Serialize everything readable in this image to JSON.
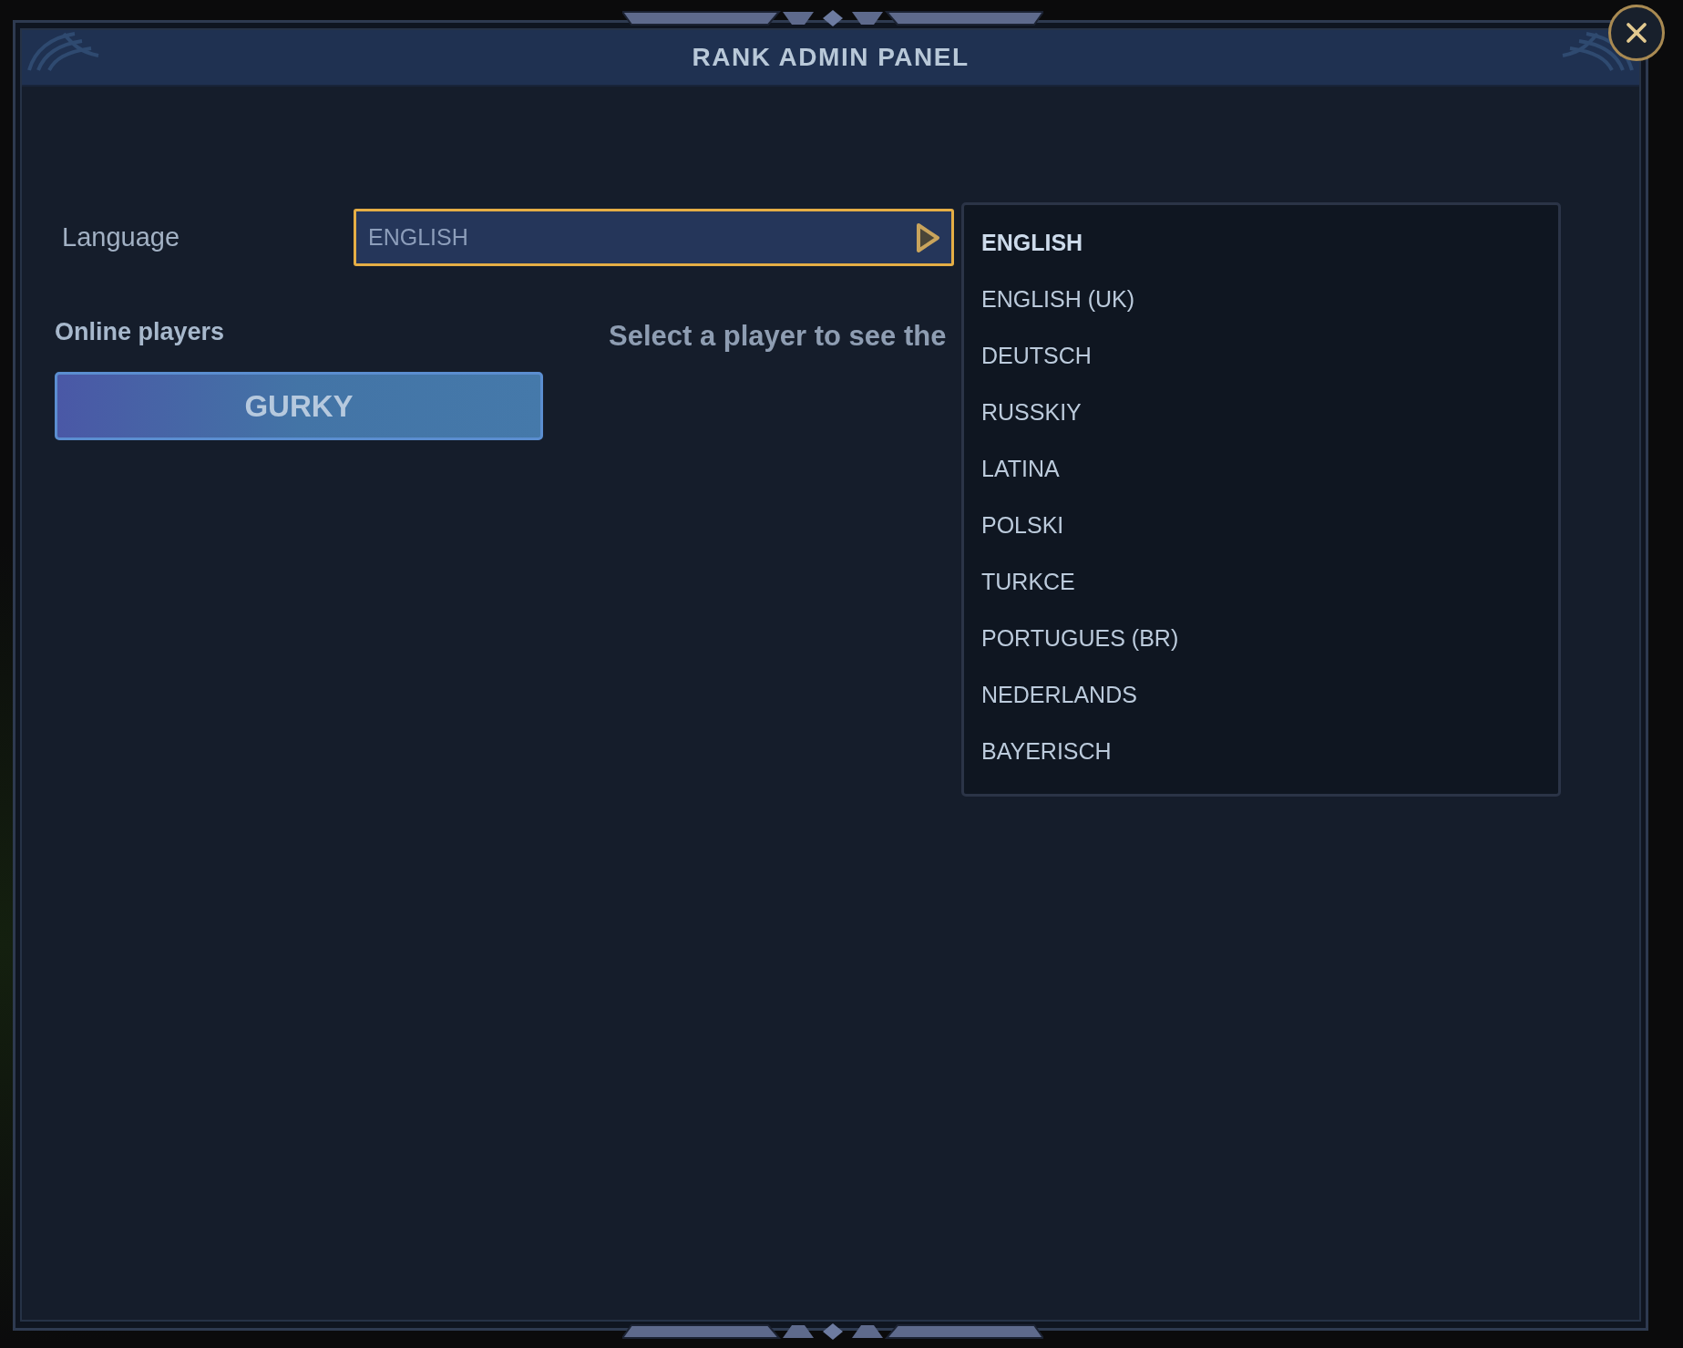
{
  "window": {
    "title": "RANK ADMIN PANEL"
  },
  "language": {
    "label": "Language",
    "value": "ENGLISH",
    "expanded": true,
    "options": [
      {
        "label": "ENGLISH",
        "selected": true
      },
      {
        "label": "ENGLISH (UK)",
        "selected": false
      },
      {
        "label": "DEUTSCH",
        "selected": false
      },
      {
        "label": "RUSSKIY",
        "selected": false
      },
      {
        "label": "LATINA",
        "selected": false
      },
      {
        "label": "POLSKI",
        "selected": false
      },
      {
        "label": "TURKCE",
        "selected": false
      },
      {
        "label": "PORTUGUES (BR)",
        "selected": false
      },
      {
        "label": "NEDERLANDS",
        "selected": false
      },
      {
        "label": "BAYERISCH",
        "selected": false
      }
    ]
  },
  "online_players": {
    "heading": "Online players",
    "players": [
      {
        "name": "GURKY",
        "selected": false
      }
    ]
  },
  "details": {
    "hint": "Select a player to see the"
  }
}
